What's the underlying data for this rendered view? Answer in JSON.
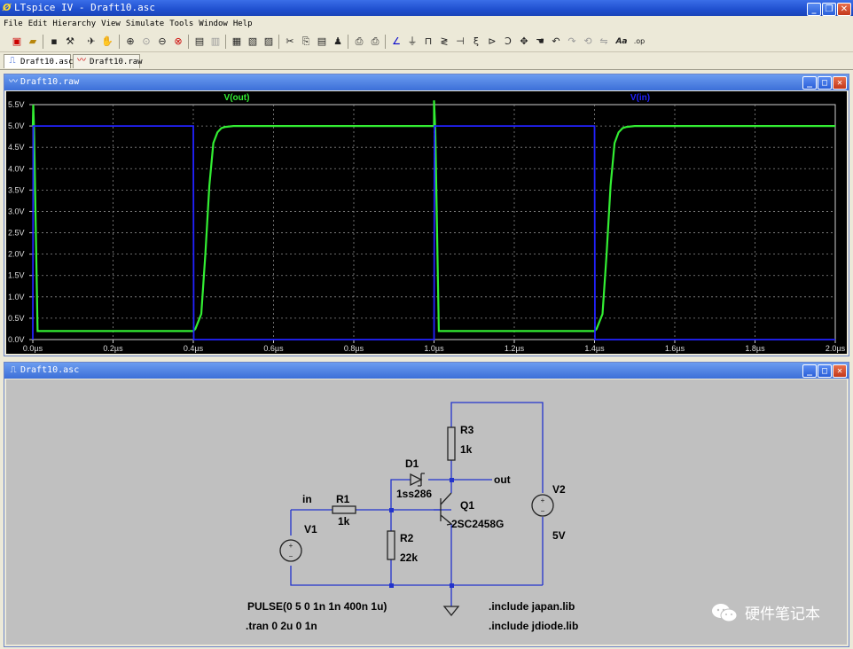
{
  "app": {
    "title": "LTspice IV - Draft10.asc",
    "logo": "ltspice-logo"
  },
  "menu": [
    "File",
    "Edit",
    "Hierarchy",
    "View",
    "Simulate",
    "Tools",
    "Window",
    "Help"
  ],
  "toolbar_icons": [
    "new-schematic",
    "open",
    "save",
    "control-panel",
    "run",
    "halt",
    "zoom-in",
    "pan",
    "zoom-out",
    "zoom-fit",
    "autorange",
    "tile-horizontal",
    "tile-vertical",
    "cascade",
    "cut",
    "copy",
    "paste",
    "find",
    "print-setup",
    "print",
    "wire",
    "ground",
    "label",
    "resistor",
    "capacitor",
    "inductor",
    "diode",
    "component",
    "move",
    "drag",
    "undo",
    "redo",
    "rotate",
    "mirror",
    "text",
    "spice-directive"
  ],
  "tabs": [
    {
      "label": "Draft10.asc",
      "icon": "schematic-icon"
    },
    {
      "label": "Draft10.raw",
      "icon": "waveform-icon"
    }
  ],
  "plot_window": {
    "title": "Draft10.raw",
    "icon": "waveform-icon"
  },
  "schematic_window": {
    "title": "Draft10.asc",
    "icon": "schematic-icon"
  },
  "chart_data": {
    "type": "line",
    "title": "",
    "xlabel": "",
    "ylabel": "",
    "xlim": [
      0,
      2.0
    ],
    "ylim": [
      0,
      5.5
    ],
    "x_unit": "µs",
    "x_ticks": [
      "0.0µs",
      "0.2µs",
      "0.4µs",
      "0.6µs",
      "0.8µs",
      "1.0µs",
      "1.2µs",
      "1.4µs",
      "1.6µs",
      "1.8µs",
      "2.0µs"
    ],
    "y_ticks": [
      "0.0V",
      "0.5V",
      "1.0V",
      "1.5V",
      "2.0V",
      "2.5V",
      "3.0V",
      "3.5V",
      "4.0V",
      "4.5V",
      "5.0V",
      "5.5V"
    ],
    "grid": true,
    "series": [
      {
        "name": "V(out)",
        "color": "#33ee33",
        "x": [
          0,
          0.001,
          0.003,
          0.012,
          0.4,
          0.405,
          0.42,
          0.43,
          0.44,
          0.45,
          0.46,
          0.47,
          0.48,
          0.5,
          0.55,
          1.0,
          1.0,
          1.003,
          1.012,
          1.4,
          1.405,
          1.42,
          1.43,
          1.44,
          1.45,
          1.46,
          1.47,
          1.48,
          1.5,
          1.55,
          2.0
        ],
        "y": [
          5.0,
          5.5,
          4.9,
          0.2,
          0.2,
          0.25,
          0.6,
          2.0,
          3.6,
          4.6,
          4.85,
          4.95,
          4.98,
          5.0,
          5.0,
          5.0,
          5.6,
          4.9,
          0.2,
          0.2,
          0.25,
          0.6,
          2.0,
          3.6,
          4.6,
          4.85,
          4.95,
          4.98,
          5.0,
          5.0,
          5.0
        ]
      },
      {
        "name": "V(in)",
        "color": "#2222ff",
        "x": [
          0,
          0.001,
          0.4,
          0.401,
          1.0,
          1.001,
          1.4,
          1.401,
          2.0
        ],
        "y": [
          0,
          5.0,
          5.0,
          0,
          0,
          5.0,
          5.0,
          0,
          0
        ]
      }
    ]
  },
  "schematic": {
    "labels": {
      "in": "in",
      "out": "out",
      "R1": "R1",
      "R1_val": "1k",
      "R2": "R2",
      "R2_val": "22k",
      "R3": "R3",
      "R3_val": "1k",
      "D1": "D1",
      "D1_val": "1ss286",
      "Q1": "Q1",
      "Q1_val": "2SC2458G",
      "V1": "V1",
      "V2": "V2",
      "V2_val": "5V"
    },
    "directives": {
      "pulse": "PULSE(0 5 0 1n 1n 400n 1u)",
      "tran": ".tran 0 2u 0 1n",
      "inc1": ".include japan.lib",
      "inc2": ".include jdiode.lib"
    },
    "watermark": "硬件笔记本"
  }
}
